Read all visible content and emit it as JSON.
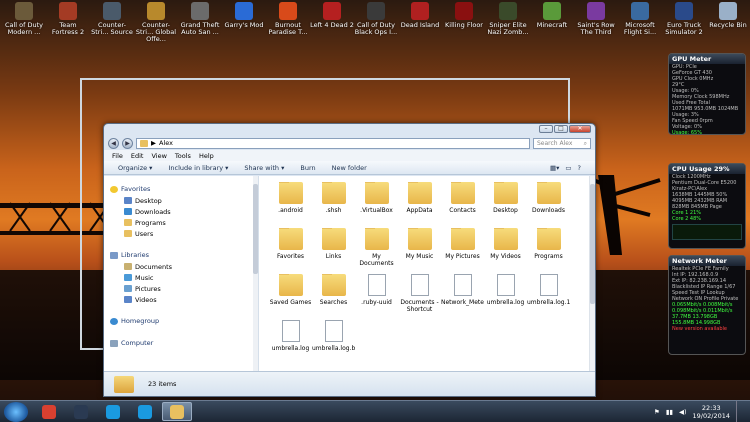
{
  "desktop": {
    "icons": [
      {
        "label": "Call of Duty Modern ...",
        "color": "#6b5a3a"
      },
      {
        "label": "Team Fortress 2",
        "color": "#a43b24"
      },
      {
        "label": "Counter-Stri... Source",
        "color": "#4a5a6a"
      },
      {
        "label": "Counter-Stri... Global Offe...",
        "color": "#b8892c"
      },
      {
        "label": "Grand Theft Auto San ...",
        "color": "#6b6b6b"
      },
      {
        "label": "Garry's Mod",
        "color": "#2a6bd6"
      },
      {
        "label": "Burnout Paradise T...",
        "color": "#d84a1a"
      },
      {
        "label": "Left 4 Dead 2",
        "color": "#b52020"
      },
      {
        "label": "Call of Duty Black Ops I...",
        "color": "#3a3a3a"
      },
      {
        "label": "Dead Island",
        "color": "#b02020"
      },
      {
        "label": "Killing Floor",
        "color": "#8a1010"
      },
      {
        "label": "Sniper Elite Nazi Zomb...",
        "color": "#3a4a2a"
      },
      {
        "label": "Minecraft",
        "color": "#5a9a3a"
      },
      {
        "label": "Saint's Row The Third",
        "color": "#7a3aa0"
      },
      {
        "label": "Microsoft Flight Si...",
        "color": "#3a6aa0"
      },
      {
        "label": "Euro Truck Simulator 2",
        "color": "#2a4a8a"
      },
      {
        "label": "Recycle Bin",
        "color": "#9ab0c8"
      }
    ]
  },
  "gadgets": {
    "gpu": {
      "title": "GPU Meter",
      "lines": [
        "GPU: PCIe",
        "GeForce GT 430",
        "GPU Clock 0MHz",
        "29°C",
        "Usage: 0%",
        "Memory Clock 598MHz",
        "Used  Free  Total",
        "1071MB  953.0MB  1024MB",
        "Usage: 3%",
        "Fan Speed 0rpm",
        "Voltage: 0%",
        "Usage: 65%",
        "Shader Clock 0MHz",
        "PCIE Temp 0%",
        "Memory Controller 0%"
      ]
    },
    "cpu": {
      "title": "CPU Usage",
      "usage": "29%",
      "lines": [
        "Clock 1200MHz",
        "Pentium Dual-Core E5200",
        "Kiratz-PC\\Alex",
        "1638MB  1445MB  50%",
        "4095MB  2432MB  RAM",
        "828MB  845MB  Page",
        "Core 1  21%",
        "Core 2  48%"
      ]
    },
    "net": {
      "title": "Network Meter",
      "lines": [
        "Realtek PCIe FE Family",
        "Int IP: 192.168.0.9",
        "Ext IP: 82.238.169.14",
        "Blacklisted IP Range 1/67",
        "Speed Test  IP Lookup",
        "Network ON  Profile Private",
        "0.065Mbit/s  0.008Mbit/s",
        "0.098Mbit/s  0.011Mbit/s",
        "37.7MB  13.798GB",
        "155.8MB  14.998GB",
        "New version available"
      ]
    }
  },
  "window": {
    "title_buttons": {
      "minimize": "–",
      "maximize": "□",
      "close": "✕"
    },
    "nav": {
      "back": "◀",
      "forward": "▶"
    },
    "address": {
      "path": "Alex",
      "separator": "▶"
    },
    "search": {
      "placeholder": "Search Alex"
    },
    "menu": [
      "File",
      "Edit",
      "View",
      "Tools",
      "Help"
    ],
    "toolbar": [
      "Organize ▾",
      "Include in library ▾",
      "Share with ▾",
      "Burn",
      "New folder"
    ],
    "navpane": {
      "favorites": {
        "label": "Favorites",
        "items": [
          "Desktop",
          "Downloads",
          "Programs",
          "Users"
        ]
      },
      "libraries": {
        "label": "Libraries",
        "items": [
          "Documents",
          "Music",
          "Pictures",
          "Videos"
        ]
      },
      "homegroup": "Homegroup",
      "computer": "Computer"
    },
    "files": [
      {
        "name": ".android",
        "kind": "folder"
      },
      {
        "name": ".shsh",
        "kind": "folder"
      },
      {
        "name": ".VirtualBox",
        "kind": "folder"
      },
      {
        "name": "AppData",
        "kind": "folder"
      },
      {
        "name": "Contacts",
        "kind": "folder"
      },
      {
        "name": "Desktop",
        "kind": "folder"
      },
      {
        "name": "Downloads",
        "kind": "folder"
      },
      {
        "name": "Favorites",
        "kind": "folder"
      },
      {
        "name": "Links",
        "kind": "folder"
      },
      {
        "name": "My Documents",
        "kind": "folder"
      },
      {
        "name": "My Music",
        "kind": "folder"
      },
      {
        "name": "My Pictures",
        "kind": "folder"
      },
      {
        "name": "My Videos",
        "kind": "folder"
      },
      {
        "name": "Programs",
        "kind": "folder"
      },
      {
        "name": "Saved Games",
        "kind": "folder"
      },
      {
        "name": "Searches",
        "kind": "folder"
      },
      {
        "name": ".ruby-uuid",
        "kind": "doc"
      },
      {
        "name": "Documents - Shortcut",
        "kind": "doc"
      },
      {
        "name": "Network_Meter_Data.js",
        "kind": "doc"
      },
      {
        "name": "umbrella.log",
        "kind": "doc"
      },
      {
        "name": "umbrella.log.1",
        "kind": "doc"
      },
      {
        "name": "umbrella.log",
        "kind": "doc"
      },
      {
        "name": "umbrella.log.bak",
        "kind": "doc"
      }
    ],
    "status": {
      "count": "23 items"
    }
  },
  "taskbar": {
    "apps": [
      {
        "name": "chrome",
        "color": "#d94030"
      },
      {
        "name": "steam",
        "color": "#2a3a52"
      },
      {
        "name": "skype",
        "color": "#1a9ae0"
      },
      {
        "name": "skype-active",
        "color": "#1a9ae0"
      },
      {
        "name": "explorer",
        "color": "#e8c060"
      }
    ],
    "time": "22:33",
    "date": "19/02/2014"
  }
}
